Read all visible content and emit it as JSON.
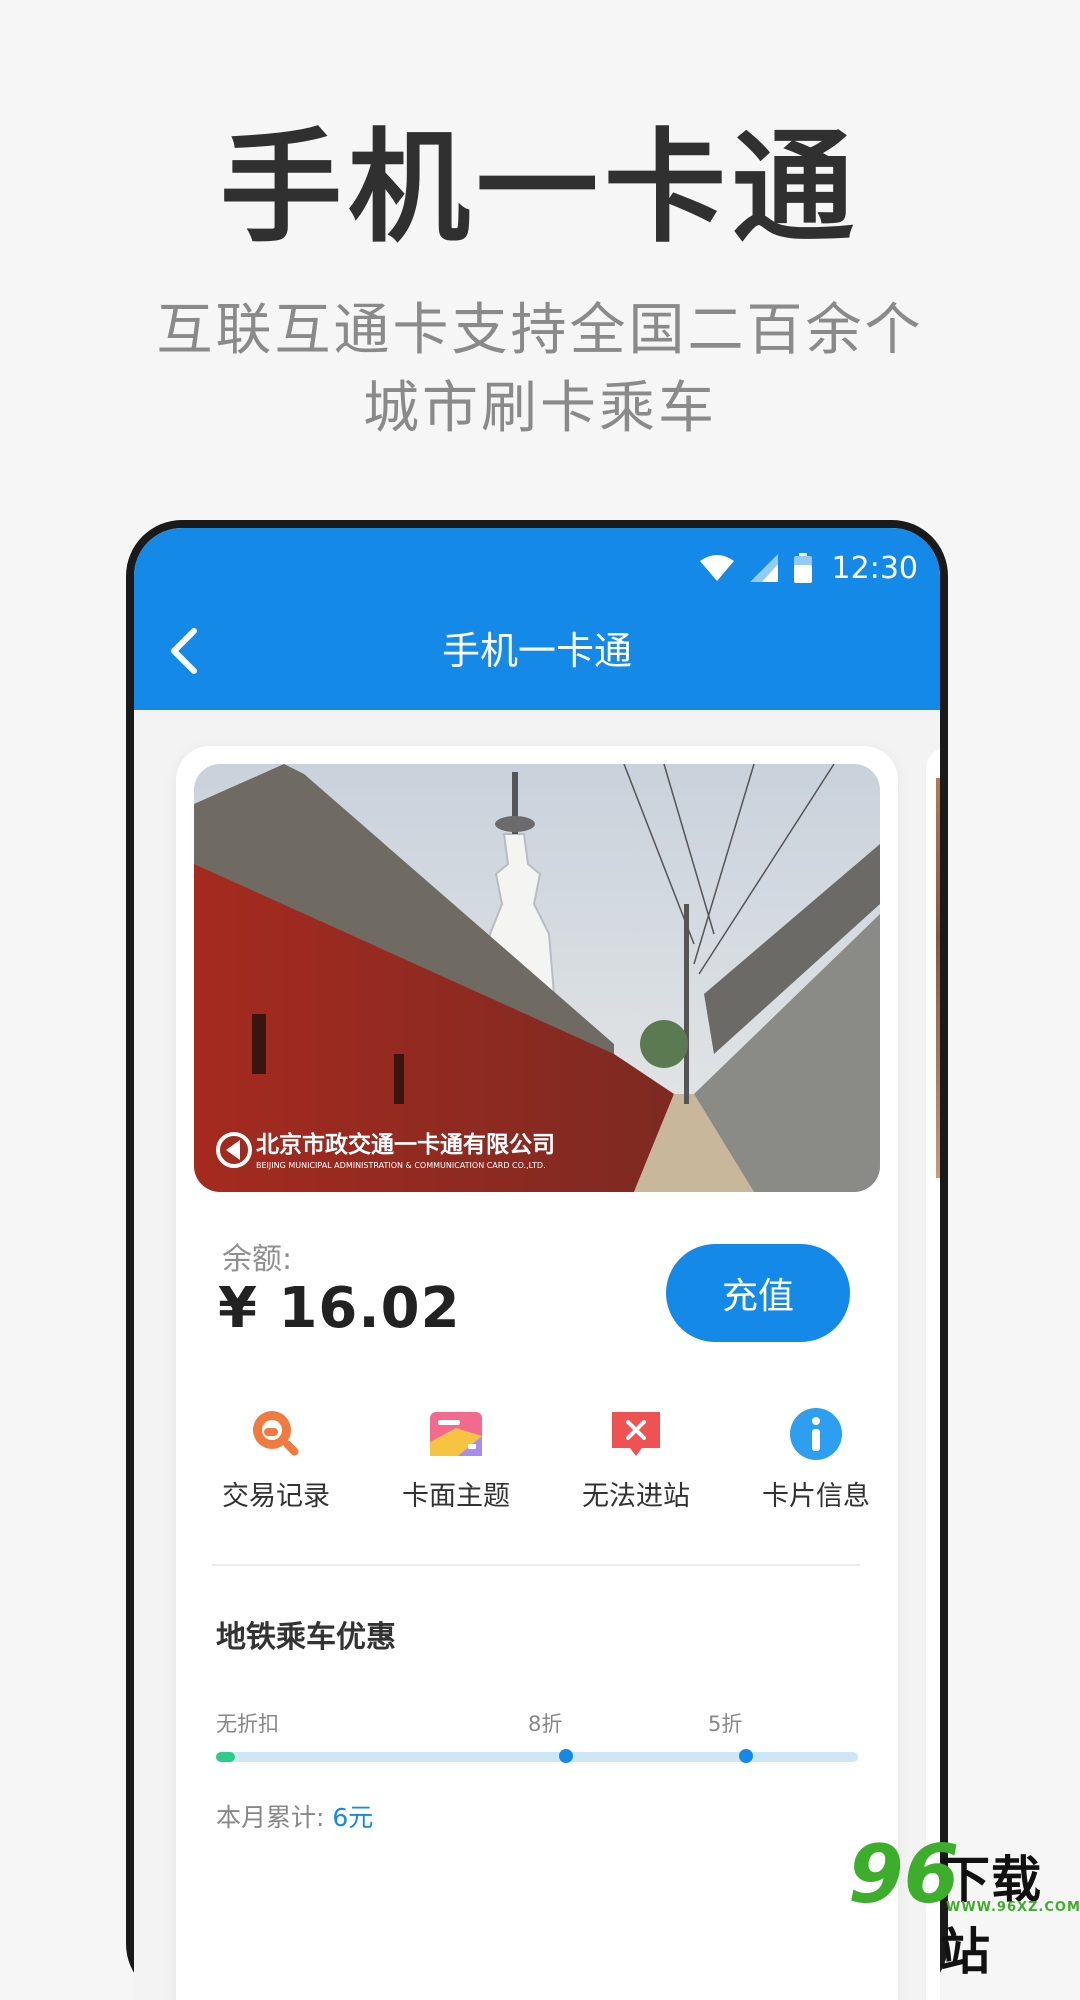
{
  "hero": {
    "title": "手机一卡通",
    "subtitle_line1": "互联互通卡支持全国二百余个",
    "subtitle_line2": "城市刷卡乘车"
  },
  "status_bar": {
    "time": "12:30",
    "icons": [
      "wifi-icon",
      "signal-icon",
      "battery-icon"
    ]
  },
  "app_bar": {
    "title": "手机一卡通",
    "back_icon": "chevron-left-icon"
  },
  "card": {
    "issuer_name_cn": "北京市政交通一卡通有限公司",
    "issuer_name_en": "BEIJING MUNICIPAL ADMINISTRATION & COMMUNICATION CARD CO.,LTD.",
    "balance_label": "余额:",
    "balance_value": "¥ 16.02",
    "recharge_label": "充值"
  },
  "actions": [
    {
      "label": "交易记录",
      "icon": "search-icon",
      "color": "#f07a3f"
    },
    {
      "label": "卡面主题",
      "icon": "card-theme-icon",
      "color": "#f2559a"
    },
    {
      "label": "无法进站",
      "icon": "close-message-icon",
      "color": "#ef5252"
    },
    {
      "label": "卡片信息",
      "icon": "info-icon",
      "color": "#2d9ef0"
    }
  ],
  "discount": {
    "title": "地铁乘车优惠",
    "ticks": [
      "无折扣",
      "8折",
      "5折"
    ],
    "progress_fraction": 0.03,
    "month_label": "本月累计: ",
    "month_value": "6元"
  },
  "watermark": {
    "number": "96",
    "text": "下载站",
    "url": "WWW.96XZ.COM"
  },
  "colors": {
    "primary": "#1589e8",
    "progress_fill": "#2ecc8a",
    "progress_track": "#cde7f7"
  }
}
